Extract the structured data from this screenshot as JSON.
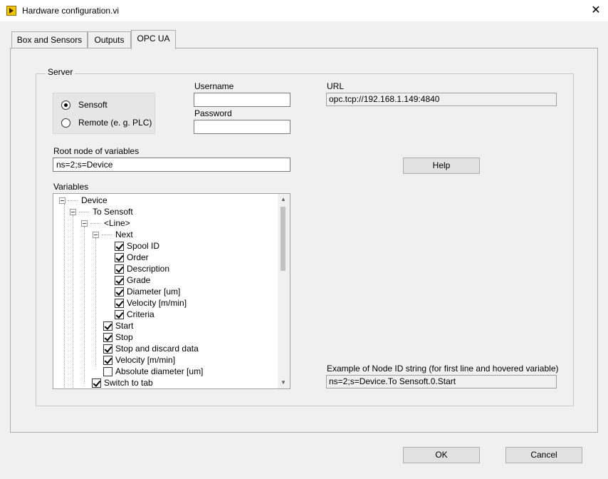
{
  "window": {
    "title": "Hardware configuration.vi",
    "close_glyph": "✕"
  },
  "tabs": [
    {
      "label": "Box and Sensors"
    },
    {
      "label": "Outputs"
    },
    {
      "label": "OPC UA"
    }
  ],
  "server": {
    "group_label": "Server",
    "radio_options": [
      {
        "label": "Sensoft",
        "selected": true
      },
      {
        "label": "Remote (e. g. PLC)",
        "selected": false
      }
    ],
    "username_label": "Username",
    "username_value": "",
    "password_label": "Password",
    "password_value": "",
    "url_label": "URL",
    "url_value": "opc.tcp://192.168.1.149:4840",
    "root_node_label": "Root node of variables",
    "root_node_value": "ns=2;s=Device",
    "help_label": "Help",
    "variables_label": "Variables",
    "example_label": "Example of Node ID string (for first line and hovered variable)",
    "example_value": "ns=2;s=Device.To Sensoft.0.Start"
  },
  "tree": {
    "nodes": [
      {
        "label": "Device",
        "level": 0,
        "kind": "expander"
      },
      {
        "label": "To Sensoft",
        "level": 1,
        "kind": "expander"
      },
      {
        "label": "<Line>",
        "level": 2,
        "kind": "expander"
      },
      {
        "label": "Next",
        "level": 3,
        "kind": "expander"
      },
      {
        "label": "Spool ID",
        "level": 4,
        "kind": "checkbox",
        "checked": true
      },
      {
        "label": "Order",
        "level": 4,
        "kind": "checkbox",
        "checked": true
      },
      {
        "label": "Description",
        "level": 4,
        "kind": "checkbox",
        "checked": true
      },
      {
        "label": "Grade",
        "level": 4,
        "kind": "checkbox",
        "checked": true
      },
      {
        "label": "Diameter [um]",
        "level": 4,
        "kind": "checkbox",
        "checked": true
      },
      {
        "label": "Velocity [m/min]",
        "level": 4,
        "kind": "checkbox",
        "checked": true
      },
      {
        "label": "Criteria",
        "level": 4,
        "kind": "checkbox",
        "checked": true
      },
      {
        "label": "Start",
        "level": 3,
        "kind": "checkbox",
        "checked": true
      },
      {
        "label": "Stop",
        "level": 3,
        "kind": "checkbox",
        "checked": true
      },
      {
        "label": "Stop and discard data",
        "level": 3,
        "kind": "checkbox",
        "checked": true
      },
      {
        "label": "Velocity [m/min]",
        "level": 3,
        "kind": "checkbox",
        "checked": true
      },
      {
        "label": "Absolute diameter [um]",
        "level": 3,
        "kind": "checkbox",
        "checked": false
      },
      {
        "label": "Switch to tab",
        "level": 2,
        "kind": "checkbox",
        "checked": true
      }
    ],
    "scroll_up_glyph": "▲",
    "scroll_down_glyph": "▼"
  },
  "footer": {
    "ok_label": "OK",
    "cancel_label": "Cancel"
  }
}
